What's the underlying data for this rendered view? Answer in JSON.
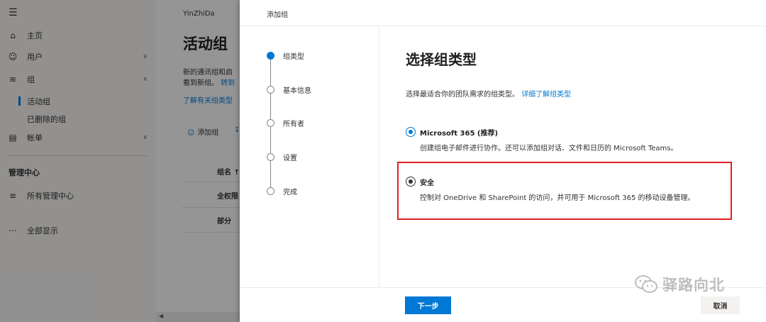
{
  "background": {
    "sidebar": {
      "menu_icon": "hamburger-icon",
      "items": [
        {
          "icon": "home-icon",
          "label": "主页",
          "chevron": ""
        },
        {
          "icon": "person-icon",
          "label": "用户",
          "chevron": "chevron-down-icon"
        },
        {
          "icon": "group-icon",
          "label": "组",
          "chevron": "chevron-up-icon"
        }
      ],
      "subitems": [
        {
          "label": "活动组",
          "active": true
        },
        {
          "label": "已删除的组",
          "active": false
        }
      ],
      "billing": {
        "icon": "card-icon",
        "label": "帐单"
      },
      "admin_center_header": "管理中心",
      "all_admin_centers": {
        "icon": "list-icon",
        "label": "所有管理中心"
      },
      "show_all": {
        "icon": "more-icon",
        "label": "全部显示"
      }
    },
    "main": {
      "org_name": "YinZhiDa",
      "title": "活动组",
      "description_line1": "新的通讯组和启",
      "description_line2": "看到新组。",
      "description_link": "转到",
      "learn_link": "了解有关组类型",
      "add_group_label": "添加组",
      "column_header": "组名 ↑",
      "rows": [
        "全权限",
        "部分"
      ]
    }
  },
  "panel": {
    "title": "添加组",
    "steps": [
      {
        "label": "组类型",
        "active": true
      },
      {
        "label": "基本信息",
        "active": false
      },
      {
        "label": "所有者",
        "active": false
      },
      {
        "label": "设置",
        "active": false
      },
      {
        "label": "完成",
        "active": false
      }
    ],
    "content_title": "选择组类型",
    "content_desc": "选择最适合你的团队需求的组类型。",
    "content_link": "详细了解组类型",
    "options": [
      {
        "title": "Microsoft 365 (推荐)",
        "desc": "创建组电子邮件进行协作。还可以添加组对话、文件和日历的 Microsoft Teams。",
        "checked": true
      },
      {
        "title": "安全",
        "desc": "控制对 OneDrive 和 SharePoint 的访问，并可用于 Microsoft 365 的移动设备管理。",
        "checked": false
      }
    ],
    "next_button": "下一步",
    "cancel_button": "取消"
  },
  "watermark": {
    "text": "驿路向北",
    "icon": "wechat-icon"
  },
  "colors": {
    "accent": "#0078d4",
    "highlight": "#e02020"
  }
}
